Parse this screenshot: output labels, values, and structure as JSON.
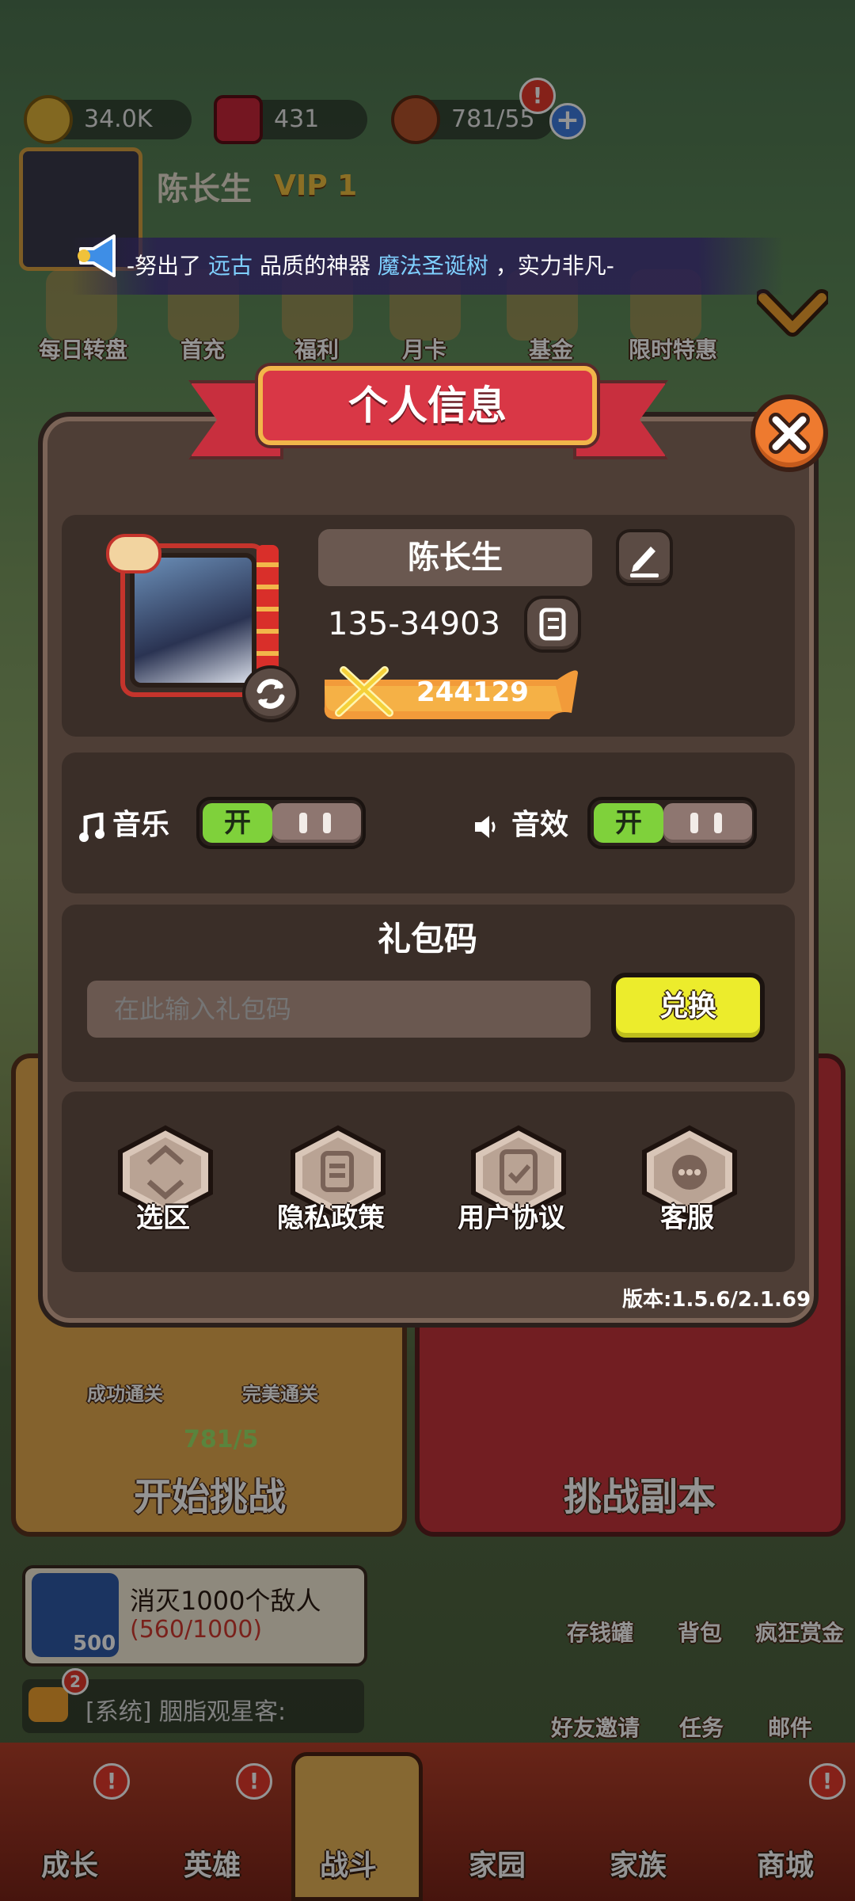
{
  "top_bar": {
    "coins": "34.0K",
    "gems": "431",
    "stamina": "781/55"
  },
  "player_header": {
    "name": "陈长生",
    "vip": "VIP 1"
  },
  "event_icons": [
    "每日转盘",
    "首充",
    "福利",
    "月卡",
    "基金",
    "限时特惠"
  ],
  "marquee": {
    "prefix": "-努出了",
    "quality": "远古",
    "middle": "品质的神器",
    "item": "魔法圣诞树",
    "suffix": "，实力非凡-"
  },
  "modal": {
    "title": "个人信息",
    "player_name": "陈长生",
    "player_id": "135-34903",
    "power": "244129",
    "music_label": "音乐",
    "music_state": "开",
    "sound_label": "音效",
    "sound_state": "开",
    "gift_code_title": "礼包码",
    "gift_code_placeholder": "在此输入礼包码",
    "redeem_label": "兑换",
    "buttons": [
      {
        "label": "选区",
        "icon": "swap-region-icon"
      },
      {
        "label": "隐私政策",
        "icon": "document-icon"
      },
      {
        "label": "用户协议",
        "icon": "clipboard-check-icon"
      },
      {
        "label": "客服",
        "icon": "chat-support-icon"
      }
    ],
    "version": "版本:1.5.6/2.1.69"
  },
  "background_stage": {
    "success_clear": "成功通关",
    "perfect_clear": "完美通关",
    "stamina_cost": "781/5",
    "start_label": "开始挑战",
    "dungeon_label": "挑战副本",
    "quest_title": "消灭1000个敌人",
    "quest_progress": "(560/1000)",
    "quest_reward": "500",
    "chat_text": "[系统] 胭脂观星客:",
    "chat_badge": "2",
    "side_buttons": [
      "存钱罐",
      "背包",
      "疯狂赏金",
      "好友邀请",
      "任务",
      "邮件"
    ]
  },
  "bottom_nav": [
    "成长",
    "英雄",
    "战斗",
    "家园",
    "家族",
    "商城"
  ],
  "colors": {
    "panel_bg": "#4e3e36",
    "title_banner": "#d93746",
    "toggle_on": "#7fd13b",
    "redeem_button": "#ecec2c",
    "close_button": "#ee7a2f"
  }
}
